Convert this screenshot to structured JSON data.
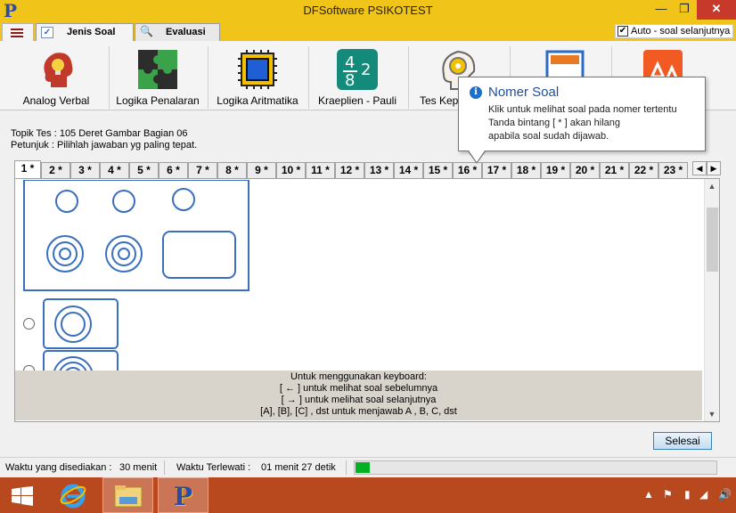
{
  "window": {
    "title": "DFSoftware PSIKOTEST",
    "minimize": "—",
    "maximize": "❐",
    "close": "✕"
  },
  "tabs": [
    {
      "label": "Jenis Soal",
      "icon": "checkbox-icon",
      "active": true
    },
    {
      "label": "Evaluasi",
      "icon": "magnifier-icon",
      "active": false
    }
  ],
  "auto_next": {
    "label": "Auto - soal selanjutnya",
    "checked": true
  },
  "toolbar": {
    "items": [
      {
        "label": "Analog Verbal",
        "icon": "head-bulb-icon"
      },
      {
        "label": "Logika Penalaran",
        "icon": "puzzle-icon"
      },
      {
        "label": "Logika Aritmatika",
        "icon": "chip-icon"
      },
      {
        "label": "Kraeplien - Pauli",
        "icon": "numbers-tile-icon",
        "icon_text": [
          "4",
          "2",
          "8",
          "2"
        ]
      },
      {
        "label": "Tes Kep",
        "icon": "head-gear-icon"
      }
    ]
  },
  "tooltip": {
    "title": "Nomer Soal",
    "lines": [
      "Klik untuk melihat soal pada nomer tertentu",
      "Tanda bintang [ * ] akan hilang",
      "apabila soal sudah dijawab."
    ]
  },
  "test": {
    "topic": "Topik Tes : 105 Deret Gambar Bagian 06",
    "instruction": "Petunjuk : Pilihlah jawaban yg paling tepat."
  },
  "number_tabs": [
    "1 *",
    "2 *",
    "3 *",
    "4 *",
    "5 *",
    "6 *",
    "7 *",
    "8 *",
    "9 *",
    "10 *",
    "11 *",
    "12 *",
    "13 *",
    "14 *",
    "15 *",
    "16 *",
    "17 *",
    "18 *",
    "19 *",
    "20 *",
    "21 *",
    "22 *",
    "23 *"
  ],
  "keyboard_help": {
    "lines": [
      "Untuk menggunakan keyboard:",
      "[ ← ] untuk melihat soal sebelumnya",
      "[ → ] untuk melihat soal selanjutnya",
      "[A], [B], [C] , dst untuk menjawab A , B, C, dst"
    ]
  },
  "submit_label": "Selesai",
  "status": {
    "time_available_label": "Waktu yang disediakan :",
    "time_available": "30 menit",
    "time_elapsed_label": "Waktu Terlewati :",
    "time_elapsed": "01 menit 27 detik",
    "progress": 0.04
  },
  "colors": {
    "titlebar": "#f0c419",
    "taskbar": "#b8491e",
    "accent_blue": "#2b6bc4",
    "figure_stroke": "#3a6fbf",
    "progress_fill": "#06b025"
  }
}
